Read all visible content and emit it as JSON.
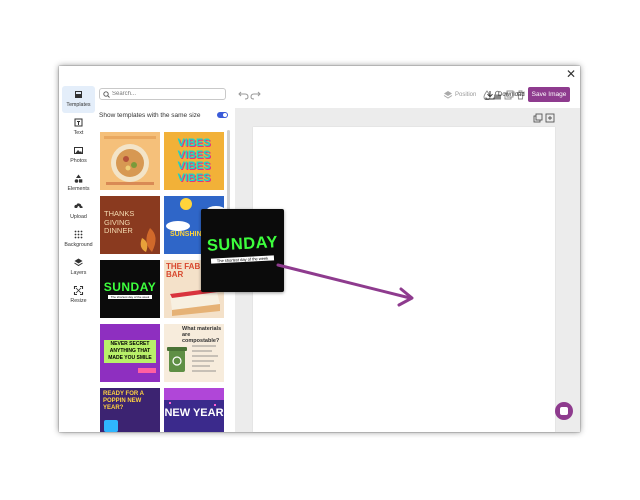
{
  "sidebar": {
    "items": [
      {
        "label": "Templates",
        "icon": "templates-icon"
      },
      {
        "label": "Text",
        "icon": "text-icon"
      },
      {
        "label": "Photos",
        "icon": "photos-icon"
      },
      {
        "label": "Elements",
        "icon": "elements-icon"
      },
      {
        "label": "Upload",
        "icon": "upload-icon"
      },
      {
        "label": "Background",
        "icon": "background-icon"
      },
      {
        "label": "Layers",
        "icon": "layers-icon"
      },
      {
        "label": "Resize",
        "icon": "resize-icon"
      }
    ]
  },
  "panel": {
    "search_placeholder": "Search...",
    "toggle_label": "Show templates with the same size",
    "toggle_on": true,
    "templates": [
      {
        "title": "",
        "bg": "#f5c07a"
      },
      {
        "title": "VIBES VIBES VIBES VIBES",
        "bg": "#f2b138"
      },
      {
        "title": "THANKS GIVING DINNER",
        "bg": "#8a3a1f"
      },
      {
        "title": "SUNSHINE",
        "bg": "#2f66c8"
      },
      {
        "title": "SUNDAY",
        "subtitle": "The shortest day of the week",
        "bg": "#0b0b0b"
      },
      {
        "title": "THE FAB BAR",
        "bg": "#f4e1c9"
      },
      {
        "title": "NEVER SECRET ANYTHING THAT MADE YOU SMILE",
        "bg": "#8e2fc0"
      },
      {
        "title": "What materials are compostable?",
        "bg": "#f7ecdc"
      },
      {
        "title": "READY FOR A POPPIN NEW YEAR?",
        "bg": "#3c2371"
      },
      {
        "title": "NEW YEAR",
        "bg": "#3b2a8c"
      }
    ]
  },
  "toolbar": {
    "position_label": "Position",
    "download_label": "Download",
    "save_label": "Save Image"
  },
  "dragged_template": {
    "title": "SUNDAY",
    "subtitle": "The shortest day of the week"
  },
  "colors": {
    "accent": "#8e3b8e",
    "toggle": "#3a5bd9",
    "sunday_green": "#3dff3d"
  }
}
